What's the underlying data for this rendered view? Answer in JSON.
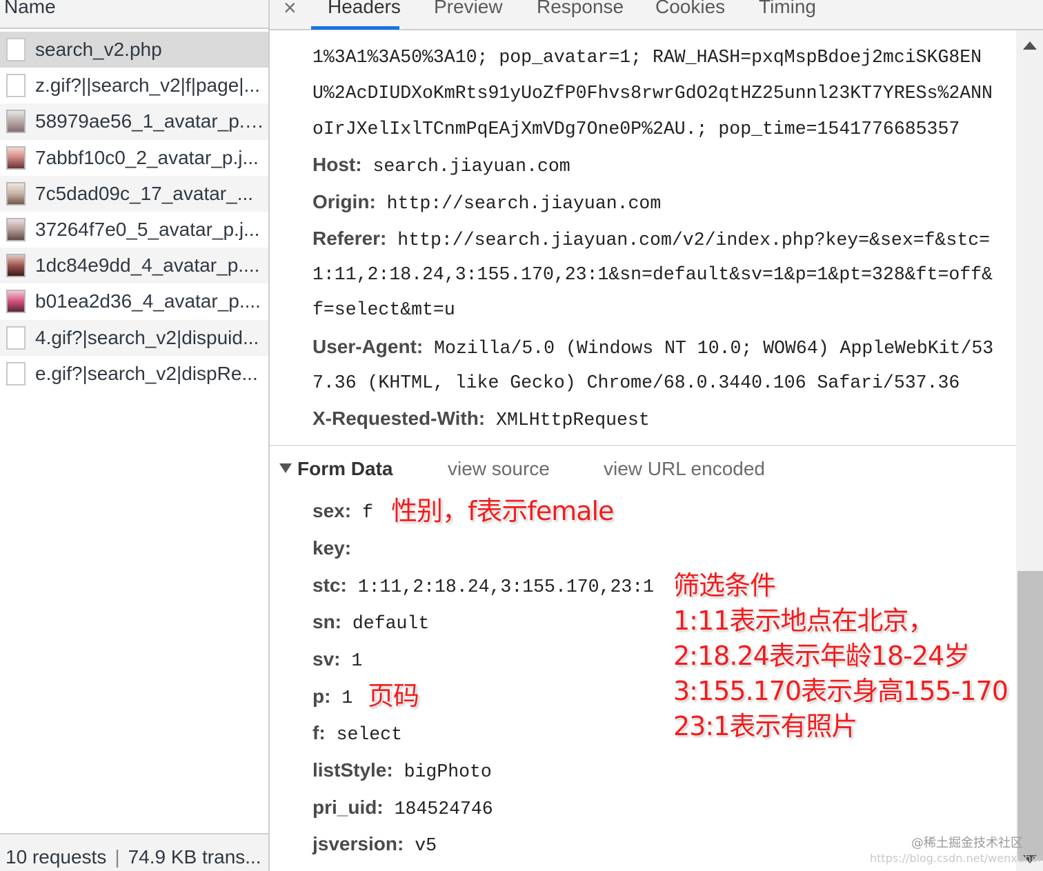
{
  "left_panel": {
    "header": "Name",
    "requests": [
      {
        "name": "search_v2.php",
        "icon": "document-icon"
      },
      {
        "name": "z.gif?||search_v2|f|page|...",
        "icon": "document-icon"
      },
      {
        "name": "58979ae56_1_avatar_p.j...",
        "icon": "image-thumbnail-icon"
      },
      {
        "name": "7abbf10c0_2_avatar_p.j...",
        "icon": "image-thumbnail-icon"
      },
      {
        "name": "7c5dad09c_17_avatar_...",
        "icon": "image-thumbnail-icon"
      },
      {
        "name": "37264f7e0_5_avatar_p.j...",
        "icon": "image-thumbnail-icon"
      },
      {
        "name": "1dc84e9dd_4_avatar_p....",
        "icon": "image-thumbnail-icon"
      },
      {
        "name": "b01ea2d36_4_avatar_p....",
        "icon": "image-thumbnail-icon"
      },
      {
        "name": "4.gif?|search_v2|dispuid...",
        "icon": "document-icon"
      },
      {
        "name": "e.gif?|search_v2|dispRe...",
        "icon": "document-icon"
      }
    ],
    "status": {
      "requests": "10 requests",
      "separator": "|",
      "transferred": "74.9 KB trans..."
    }
  },
  "tabs": {
    "close": "×",
    "items": [
      "Headers",
      "Preview",
      "Response",
      "Cookies",
      "Timing"
    ],
    "active": "Headers"
  },
  "headers": {
    "cookie_lines": [
      "1%3A1%3A50%3A10; pop_avatar=1; RAW_HASH=pxqMspBdoej2mciSKG8EN",
      "U%2AcDIUDXoKmRts91yUoZfP0Fhvs8rwrGdO2qtHZ25unnl23KT7YRESs%2ANN",
      "oIrJXelIxlTCnmPqEAjXmVDg7One0P%2AU.; pop_time=1541776685357"
    ],
    "host": {
      "key": "Host:",
      "value": "search.jiayuan.com"
    },
    "origin": {
      "key": "Origin:",
      "value": "http://search.jiayuan.com"
    },
    "referer": {
      "key": "Referer:",
      "lines": [
        "http://search.jiayuan.com/v2/index.php?key=&sex=f&stc=",
        "1:11,2:18.24,3:155.170,23:1&sn=default&sv=1&p=1&pt=328&ft=off&",
        "f=select&mt=u"
      ]
    },
    "user_agent": {
      "key": "User-Agent:",
      "lines": [
        "Mozilla/5.0 (Windows NT 10.0; WOW64) AppleWebKit/53",
        "7.36 (KHTML, like Gecko) Chrome/68.0.3440.106 Safari/537.36"
      ]
    },
    "x_requested_with": {
      "key": "X-Requested-With:",
      "value": "XMLHttpRequest"
    }
  },
  "form_data": {
    "title": "Form Data",
    "view_source": "view source",
    "view_url_encoded": "view URL encoded",
    "fields": [
      {
        "key": "sex:",
        "value": "f"
      },
      {
        "key": "key:",
        "value": ""
      },
      {
        "key": "stc:",
        "value": "1:11,2:18.24,3:155.170,23:1"
      },
      {
        "key": "sn:",
        "value": "default"
      },
      {
        "key": "sv:",
        "value": "1"
      },
      {
        "key": "p:",
        "value": "1"
      },
      {
        "key": "f:",
        "value": "select"
      },
      {
        "key": "listStyle:",
        "value": "bigPhoto"
      },
      {
        "key": "pri_uid:",
        "value": "184524746"
      },
      {
        "key": "jsversion:",
        "value": "v5"
      }
    ]
  },
  "annotations": {
    "sex_note": "性别，f表示female",
    "page_note": "页码",
    "stc_notes": [
      "筛选条件",
      "1:11表示地点在北京，",
      "2:18.24表示年龄18-24岁",
      "3:155.170表示身高155-170",
      "23:1表示有照片"
    ],
    "color": "#f21c1c"
  },
  "watermark": {
    "line1": "@稀土掘金技术社区",
    "line2": "https://blog.csdn.net/wenxuhonghe"
  }
}
